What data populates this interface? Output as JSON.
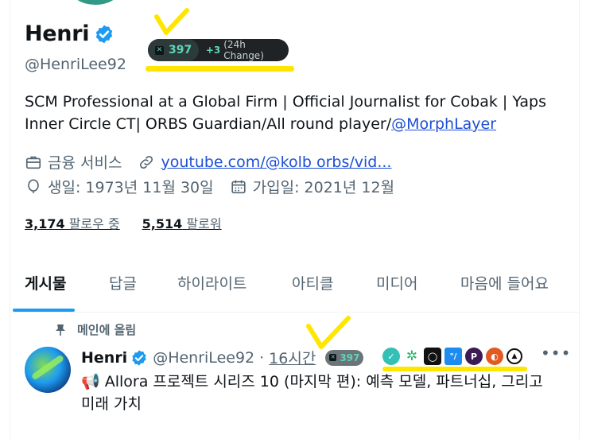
{
  "profile": {
    "name": "Henri",
    "handle": "@HenriLee92",
    "score": "397",
    "score_change": "+3",
    "score_change_label": "(24h Change)",
    "bio_text": "SCM Professional at a Global Firm | Official Journalist for Cobak | Yaps Inner Circle CT| ORBS Guardian/All round player/",
    "bio_mention": "@MorphLayer",
    "category": "금융 서비스",
    "website": "youtube.com/@kolb orbs/vid...",
    "birth": "생일: 1973년 11월 30일",
    "joined": "가입일: 2021년 12월",
    "following_count": "3,174",
    "following_label": "팔로우 중",
    "followers_count": "5,514",
    "followers_label": "팔로워"
  },
  "tabs": [
    "게시물",
    "답글",
    "하이라이트",
    "아티클",
    "미디어",
    "마음에 들어요"
  ],
  "pinned_label": "메인에 올림",
  "post": {
    "name": "Henri",
    "handle": "@HenriLee92",
    "time": "16시간",
    "score": "397",
    "text": "📢 Allora 프로젝트 시리즈 10 (마지막 편): 예측 모델, 파트너십, 그리고 미래 가치"
  },
  "colors": {
    "accent": "#1d9bf0",
    "verified": "#1d9bf0",
    "highlight": "#ffe600",
    "score_green": "#5fd3b8"
  },
  "icons": {
    "verified": "verified-badge-icon",
    "category": "briefcase-icon",
    "website": "link-icon",
    "birth": "balloon-icon",
    "joined": "calendar-icon",
    "pinned": "pin-icon",
    "more": "more-icon"
  }
}
